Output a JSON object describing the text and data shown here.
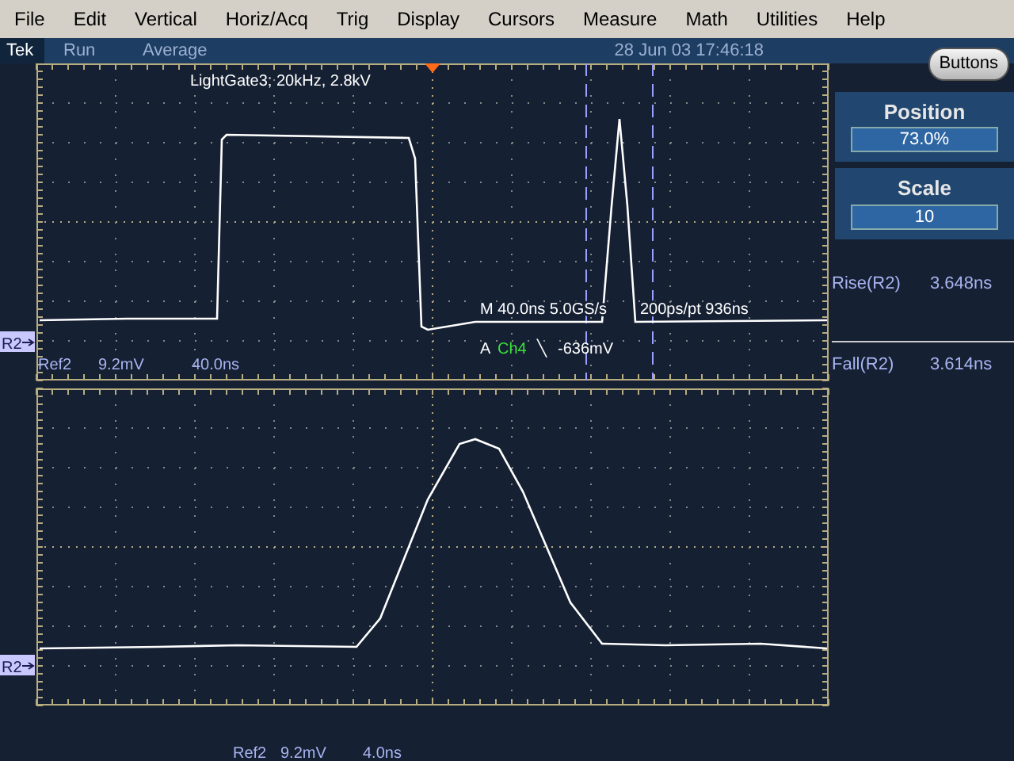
{
  "menu": [
    "File",
    "Edit",
    "Vertical",
    "Horiz/Acq",
    "Trig",
    "Display",
    "Cursors",
    "Measure",
    "Math",
    "Utilities",
    "Help"
  ],
  "status": {
    "brand": "Tek",
    "run_state": "Run",
    "acquisition": "Average",
    "datetime": "28 Jun 03 17:46:18"
  },
  "buttons_button": "Buttons",
  "upper_display": {
    "title": "LightGate3; 20kHz, 2.8kV",
    "ref_marker": "R2",
    "ref_label": "Ref2",
    "ref_scale": "9.2mV",
    "ref_time": "40.0ns",
    "horizontal_readout": "M 40.0ns 5.0GS/s",
    "sample_readout": "200ps/pt 936ns",
    "trigger_label": "A",
    "trigger_source": "Ch4",
    "trigger_slope": "╲",
    "trigger_level": "-636mV"
  },
  "lower_display": {
    "ref_marker": "R2",
    "ref_label": "Ref2",
    "ref_scale": "9.2mV",
    "ref_time": "4.0ns"
  },
  "controls": [
    {
      "label": "Position",
      "value": "73.0%"
    },
    {
      "label": "Scale",
      "value": "10"
    }
  ],
  "measurements": [
    {
      "name": "Rise(R2)",
      "value": "3.648ns"
    },
    {
      "name": "Fall(R2)",
      "value": "3.614ns"
    }
  ]
}
